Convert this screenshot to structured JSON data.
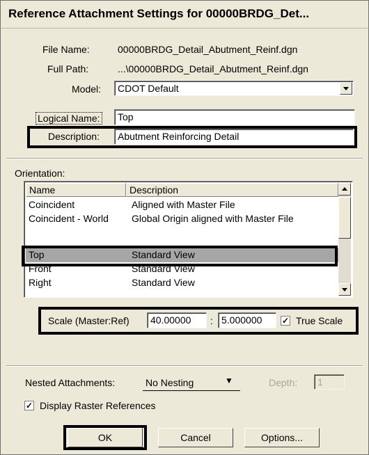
{
  "window": {
    "title": "Reference Attachment Settings for 00000BRDG_Det..."
  },
  "info": {
    "file_name_label": "File Name:",
    "file_name_value": "00000BRDG_Detail_Abutment_Reinf.dgn",
    "full_path_label": "Full Path:",
    "full_path_value": "...\\00000BRDG_Detail_Abutment_Reinf.dgn",
    "model_label": "Model:",
    "model_value": "CDOT Default",
    "logical_name_label": "Logical Name:",
    "logical_name_value": "Top",
    "description_label": "Description:",
    "description_value": "Abutment Reinforcing Detail"
  },
  "orientation": {
    "label": "Orientation:",
    "columns": [
      "Name",
      "Description"
    ],
    "rows": [
      {
        "name": "Coincident",
        "description": "Aligned with Master File"
      },
      {
        "name": "Coincident - World",
        "description": "Global Origin aligned with Master File"
      },
      {
        "name": "",
        "description": ""
      },
      {
        "name": "Top",
        "description": "Standard View",
        "selected": true
      },
      {
        "name": "Front",
        "description": "Standard View"
      },
      {
        "name": "Right",
        "description": "Standard View"
      }
    ]
  },
  "scale": {
    "label": "Scale (Master:Ref)",
    "master_value": "40.00000",
    "separator": ":",
    "ref_value": "5.000000",
    "true_scale_label": "True Scale",
    "true_scale_checked": true
  },
  "nested": {
    "label": "Nested Attachments:",
    "value": "No Nesting",
    "depth_label": "Depth:",
    "depth_value": "1"
  },
  "raster": {
    "label": "Display Raster References",
    "checked": true
  },
  "buttons": {
    "ok": "OK",
    "cancel": "Cancel",
    "options": "Options..."
  },
  "colors": {
    "dialog_bg": "#ece9d8",
    "selection": "#a6a6a6",
    "highlight_border": "#000000"
  }
}
